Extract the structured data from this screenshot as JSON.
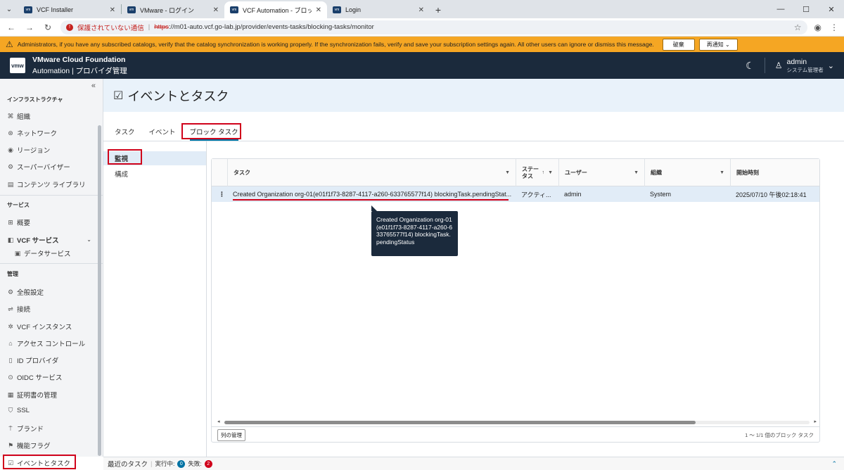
{
  "browser": {
    "tabs": [
      {
        "title": "VCF Installer",
        "active": false
      },
      {
        "title": "VMware - ログイン",
        "active": false
      },
      {
        "title": "VCF Automation - ブロック タスク",
        "active": true
      },
      {
        "title": "Login",
        "active": false
      }
    ],
    "security_label": "保護されていない通信",
    "url_scheme": "https",
    "url_rest": "://m01-auto.vcf.go-lab.jp/provider/events-tasks/blocking-tasks/monitor"
  },
  "banner": {
    "message": "Administrators, if you have any subscribed catalogs, verify that the catalog synchronization is working properly. If the synchronization fails, verify and save your subscription settings again. All other users can ignore or dismiss this message.",
    "dismiss_label": "破棄",
    "remind_label": "再通知",
    "color": "#f5a623"
  },
  "header": {
    "logo": "vmw",
    "brand_line1": "VMware Cloud Foundation",
    "brand_line2": "Automation | プロバイダ管理",
    "user_name": "admin",
    "user_role": "システム管理者"
  },
  "sidebar": {
    "sections": {
      "infra": "インフラストラクチャ",
      "services": "サービス",
      "admin": "管理"
    },
    "items": {
      "org": "組織",
      "network": "ネットワーク",
      "region": "リージョン",
      "supervisor": "スーパーバイザー",
      "content_library": "コンテンツ ライブラリ",
      "overview": "概要",
      "vcf_services": "VCF サービス",
      "data_services": "データサービス",
      "general": "全般設定",
      "connections": "接続",
      "vcf_instances": "VCF インスタンス",
      "access_control": "アクセス コントロール",
      "id_provider": "ID プロバイダ",
      "oidc": "OIDC サービス",
      "certs": "証明書の管理",
      "ssl": "SSL",
      "brand": "ブランド",
      "feature_flags": "機能フラグ",
      "events_tasks": "イベントとタスク"
    }
  },
  "page": {
    "title": "イベントとタスク",
    "tabs": [
      "タスク",
      "イベント",
      "ブロック タスク"
    ],
    "active_tab": "ブロック タスク",
    "subnav": [
      "監視",
      "構成"
    ]
  },
  "grid": {
    "columns": {
      "task": "タスク",
      "status": "ステータス",
      "user": "ユーザー",
      "org": "組織",
      "start": "開始時刻"
    },
    "rows": [
      {
        "task": "Created Organization org-01(e01f1f73-8287-4117-a260-633765577f14) blockingTask.pendingStat...",
        "status": "アクティ...",
        "user": "admin",
        "org": "System",
        "start": "2025/07/10 午後02:18:41"
      }
    ],
    "tooltip": "Created Organization org-01(e01f1f73-8287-4117-a260-633765577f14) blockingTask.pendingStatus",
    "manage_columns": "列の管理",
    "count_text": "1 ～ 1/1 個のブロック タスク"
  },
  "bottom": {
    "recent_tasks": "最近のタスク",
    "running_label": "実行中:",
    "running_count": "0",
    "failed_label": "失敗:",
    "failed_count": "2"
  }
}
